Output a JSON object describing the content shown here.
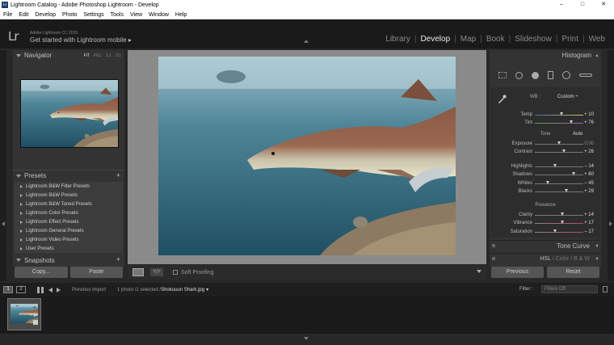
{
  "titlebar": {
    "title": "Lightroom Catalog - Adobe Photoshop Lightroom - Develop",
    "minimize": "–",
    "maximize": "□",
    "close": "✕"
  },
  "menu": [
    "File",
    "Edit",
    "Develop",
    "Photo",
    "Settings",
    "Tools",
    "View",
    "Window",
    "Help"
  ],
  "identity": {
    "logo": "Lr",
    "version": "Adobe Lightroom CC 2015",
    "promo": "Get started with Lightroom mobile ▸"
  },
  "modules": [
    "Library",
    "Develop",
    "Map",
    "Book",
    "Slideshow",
    "Print",
    "Web"
  ],
  "active_module": "Develop",
  "navigator": {
    "title": "Navigator",
    "zoom": [
      "FIT",
      "FILL",
      "1:1",
      "3:1"
    ],
    "zoom_selected": "FIT"
  },
  "presets": {
    "title": "Presets",
    "add": "+",
    "items": [
      "Lightroom B&W Filter Presets",
      "Lightroom B&W Presets",
      "Lightroom B&W Toned Presets",
      "Lightroom Color Presets",
      "Lightroom Effect Presets",
      "Lightroom General Presets",
      "Lightroom Video Presets",
      "User Presets"
    ]
  },
  "snapshots": {
    "title": "Snapshots",
    "add": "+"
  },
  "left_buttons": {
    "copy": "Copy...",
    "paste": "Paste"
  },
  "toolbar": {
    "yy": "Y|Y",
    "soft_proofing": "Soft Proofing"
  },
  "histogram": {
    "title": "Histogram"
  },
  "basic": {
    "wb_label": "WB :",
    "wb_value": "Custom ÷",
    "temp": {
      "label": "Temp",
      "value": "+ 10",
      "level": 0.55
    },
    "tint": {
      "label": "Tint",
      "value": "+ 76",
      "level": 0.76
    },
    "tone_title": "Tone",
    "auto": "Auto",
    "exposure": {
      "label": "Exposure",
      "value": "0.00",
      "level": 0.5
    },
    "contrast": {
      "label": "Contrast",
      "value": "+ 26",
      "level": 0.6
    },
    "highlights": {
      "label": "Highlights",
      "value": "– 14",
      "level": 0.43
    },
    "shadows": {
      "label": "Shadows",
      "value": "+ 60",
      "level": 0.8
    },
    "whites": {
      "label": "Whites",
      "value": "– 45",
      "level": 0.27
    },
    "blacks": {
      "label": "Blacks",
      "value": "+ 29",
      "level": 0.65
    },
    "presence_title": "Presence",
    "clarity": {
      "label": "Clarity",
      "value": "+ 14",
      "level": 0.57
    },
    "vibrance": {
      "label": "Vibrance",
      "value": "+ 17",
      "level": 0.58
    },
    "saturation": {
      "label": "Saturation",
      "value": "– 17",
      "level": 0.42
    }
  },
  "tone_curve": {
    "title": "Tone Curve"
  },
  "hsl": {
    "hsl": "HSL",
    "sep": "/",
    "color": "Color",
    "bw": "B & W"
  },
  "right_buttons": {
    "previous": "Previous",
    "reset": "Reset"
  },
  "filmstrip_bar": {
    "screen1": "1",
    "screen2": "2",
    "source": "Previous Import",
    "info": "1 photo /1 selected /",
    "filename": "Shokuuun Shark.jpg",
    "filename_suffix": "▾",
    "filter_label": "Filter :",
    "filter_value": "Filters Off"
  }
}
